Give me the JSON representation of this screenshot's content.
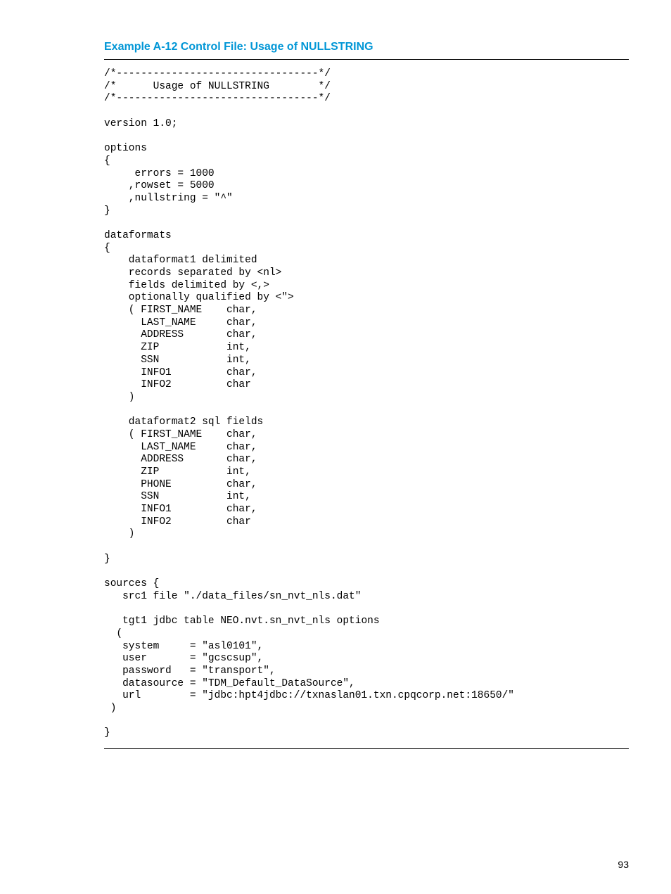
{
  "example_title": "Example  A-12  Control File: Usage of NULLSTRING",
  "code_lines": [
    "/*---------------------------------*/",
    "/*      Usage of NULLSTRING        */",
    "/*---------------------------------*/",
    "",
    "version 1.0;",
    "",
    "options",
    "{",
    "     errors = 1000",
    "    ,rowset = 5000",
    "    ,nullstring = \"^\"",
    "}",
    "",
    "dataformats",
    "{",
    "    dataformat1 delimited",
    "    records separated by <nl>",
    "    fields delimited by <,>",
    "    optionally qualified by <\">",
    "    ( FIRST_NAME    char,",
    "      LAST_NAME     char,",
    "      ADDRESS       char,",
    "      ZIP           int,",
    "      SSN           int,",
    "      INFO1         char,",
    "      INFO2         char",
    "    )",
    "",
    "    dataformat2 sql fields",
    "    ( FIRST_NAME    char,",
    "      LAST_NAME     char,",
    "      ADDRESS       char,",
    "      ZIP           int,",
    "      PHONE         char,",
    "      SSN           int,",
    "      INFO1         char,",
    "      INFO2         char",
    "    )",
    "",
    "}",
    "",
    "sources {",
    "   src1 file \"./data_files/sn_nvt_nls.dat\"",
    "",
    "   tgt1 jdbc table NEO.nvt.sn_nvt_nls options",
    "  (",
    "   system     = \"asl0101\",",
    "   user       = \"gcscsup\",",
    "   password   = \"transport\",",
    "   datasource = \"TDM_Default_DataSource\",",
    "   url        = \"jdbc:hpt4jdbc://txnaslan01.txn.cpqcorp.net:18650/\"",
    " )",
    "",
    "}"
  ],
  "page_number": "93"
}
